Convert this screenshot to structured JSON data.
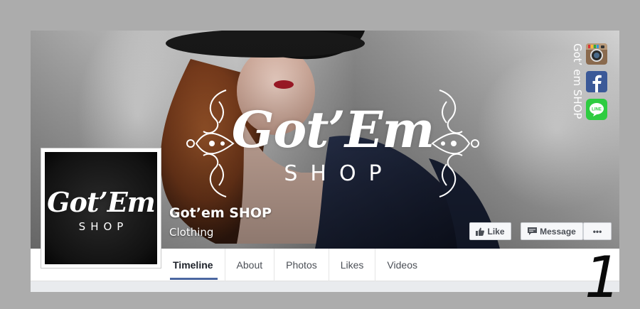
{
  "cover": {
    "brand_script": "Got’Em",
    "brand_sub": "SHOP",
    "social_label": "Got’ em SHOP",
    "icons": [
      "instagram-icon",
      "facebook-icon",
      "line-icon"
    ],
    "line_label": "LINE"
  },
  "profile": {
    "brand_script": "Got’Em",
    "brand_sub": "SHOP"
  },
  "page": {
    "name": "Got’em SHOP",
    "category": "Clothing"
  },
  "actions": {
    "like_label": "Like",
    "message_label": "Message",
    "more_label": "•••"
  },
  "nav": {
    "tabs": [
      {
        "label": "Timeline",
        "active": true
      },
      {
        "label": "About",
        "active": false
      },
      {
        "label": "Photos",
        "active": false
      },
      {
        "label": "Likes",
        "active": false
      },
      {
        "label": "Videos",
        "active": false
      }
    ]
  },
  "annotation": {
    "number": "1"
  },
  "colors": {
    "background": "#acacac",
    "accent": "#4b67a1",
    "facebook_blue": "#3b5998",
    "line_green": "#2ecc40"
  }
}
